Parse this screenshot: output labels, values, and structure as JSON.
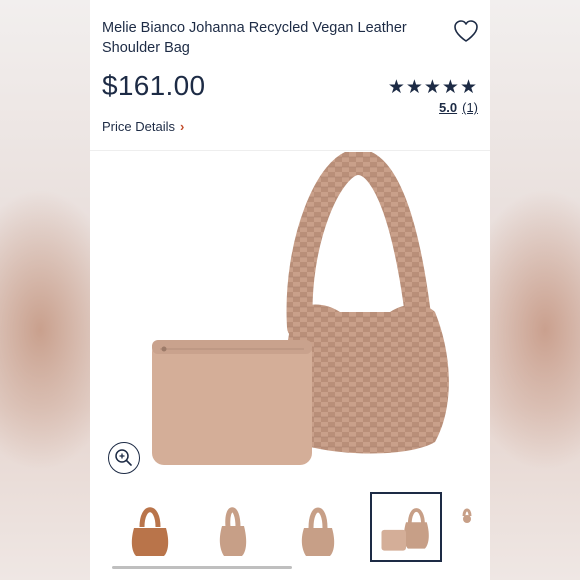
{
  "product": {
    "title": "Melie Bianco Johanna Recycled Vegan Leather Shoulder Bag",
    "price": "$161.00",
    "stars": "★★★★★",
    "rating_score": "5.0",
    "rating_count": "(1)",
    "price_details_label": "Price Details",
    "price_details_chevron": "›"
  },
  "icons": {
    "heart": "heart-icon",
    "zoom": "zoom-in-icon",
    "chevron": "chevron-right-icon"
  },
  "thumbnails": {
    "count": 5,
    "active_index": 3
  },
  "colors": {
    "text": "#1d2b45",
    "accent": "#c24d2c",
    "bag_tan": "#c79f87",
    "bag_cognac": "#b9744a"
  }
}
